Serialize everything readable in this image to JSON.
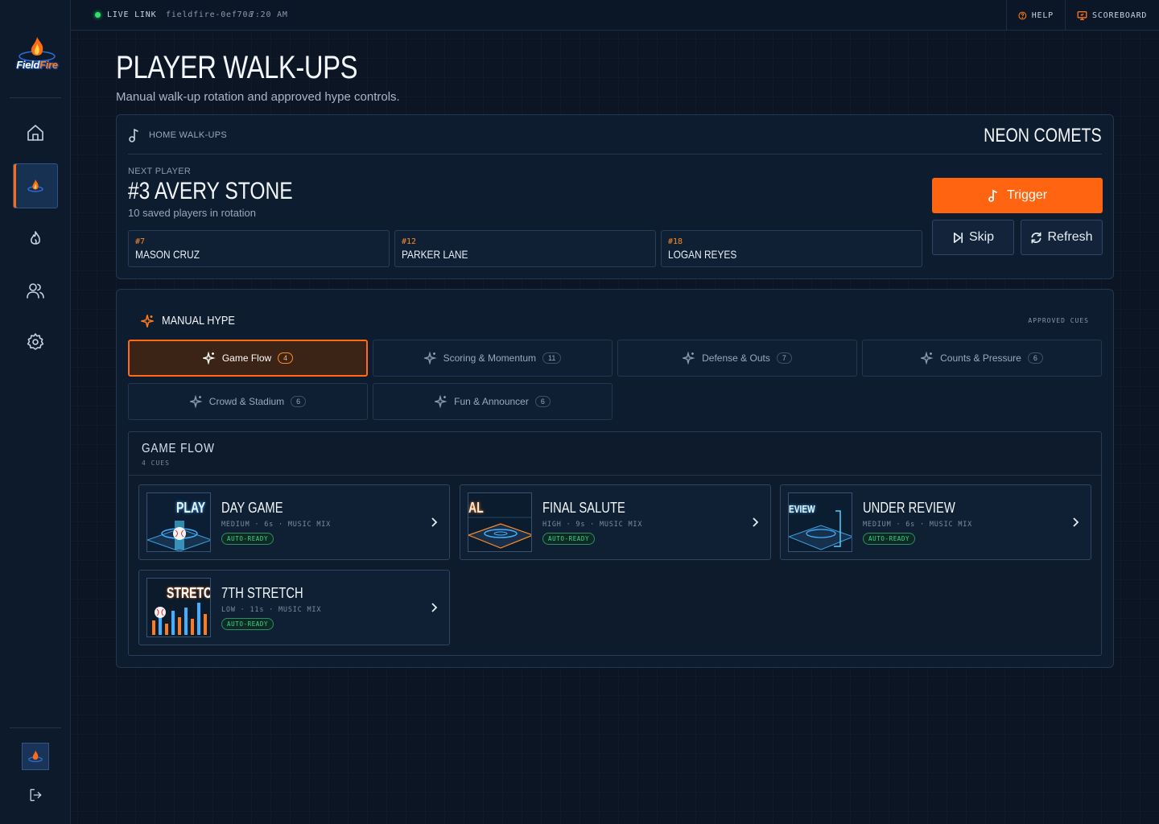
{
  "topbar": {
    "live_label": "LIVE LINK",
    "session_id": "fieldfire-0ef70a",
    "time": "7:20 AM",
    "help_label": "HELP",
    "scoreboard_label": "SCOREBOARD"
  },
  "brand": {
    "logo_text_a": "Field",
    "logo_text_b": "Fire",
    "accent": "#ff6410"
  },
  "header": {
    "title": "PLAYER WALK-UPS",
    "subtitle": "Manual walk-up rotation and approved hype controls."
  },
  "walkups": {
    "section_label": "HOME WALK-UPS",
    "team": "NEON COMETS",
    "next_label": "NEXT PLAYER",
    "next_player": "#3 AVERY STONE",
    "rotation_text": "10 saved players in rotation",
    "upcoming": [
      {
        "number": "#7",
        "name": "MASON CRUZ"
      },
      {
        "number": "#12",
        "name": "PARKER LANE"
      },
      {
        "number": "#18",
        "name": "LOGAN REYES"
      }
    ],
    "trigger_label": "Trigger",
    "skip_label": "Skip",
    "refresh_label": "Refresh"
  },
  "hype": {
    "title": "MANUAL HYPE",
    "approved_label": "APPROVED CUES",
    "tabs": [
      {
        "label": "Game Flow",
        "count": "4",
        "active": true
      },
      {
        "label": "Scoring & Momentum",
        "count": "11"
      },
      {
        "label": "Defense & Outs",
        "count": "7"
      },
      {
        "label": "Counts & Pressure",
        "count": "6"
      },
      {
        "label": "Crowd & Stadium",
        "count": "6"
      },
      {
        "label": "Fun & Announcer",
        "count": "6"
      }
    ],
    "group_title": "GAME FLOW",
    "group_count": "4 CUES",
    "cues": [
      {
        "title": "DAY GAME",
        "meta": "MEDIUM · 6s · MUSIC MIX",
        "badge": "AUTO-READY",
        "thumb_word": "PLAY"
      },
      {
        "title": "FINAL SALUTE",
        "meta": "HIGH · 9s · MUSIC MIX",
        "badge": "AUTO-READY",
        "thumb_word": "AL"
      },
      {
        "title": "UNDER REVIEW",
        "meta": "MEDIUM · 6s · MUSIC MIX",
        "badge": "AUTO-READY",
        "thumb_word": "EVIEW"
      },
      {
        "title": "7TH STRETCH",
        "meta": "LOW · 11s · MUSIC MIX",
        "badge": "AUTO-READY",
        "thumb_word": "STRETC"
      }
    ]
  }
}
